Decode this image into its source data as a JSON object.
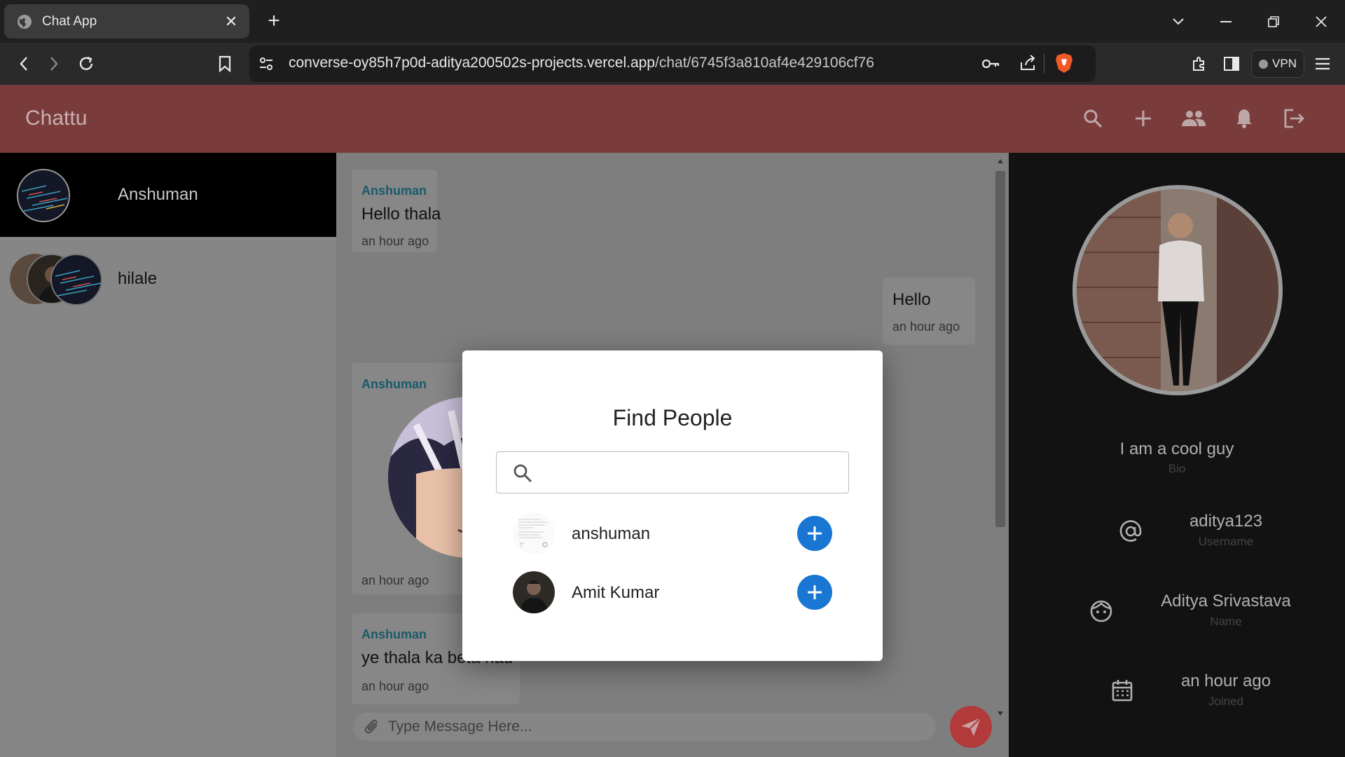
{
  "browser": {
    "tab_title": "Chat App",
    "url_host": "converse-oy85h7p0d-aditya200502s-projects.vercel.app",
    "url_path": "/chat/6745f3a810af4e429106cf76",
    "vpn_label": "VPN"
  },
  "app": {
    "brand": "Chattu",
    "header_color": "#7a3b3b"
  },
  "sidebar": {
    "chats": [
      {
        "name": "Anshuman",
        "active": true
      },
      {
        "name": "hilale",
        "active": false
      }
    ]
  },
  "messages": [
    {
      "sender": "Anshuman",
      "text": "Hello thala",
      "time": "an hour ago"
    },
    {
      "sender": "",
      "text": "Hello",
      "time": "an hour ago"
    },
    {
      "sender": "Anshuman",
      "text": "",
      "time": "an hour ago"
    },
    {
      "sender": "Anshuman",
      "text": "ye thala ka beta hau",
      "time": "an hour ago"
    }
  ],
  "composer": {
    "placeholder": "Type Message Here..."
  },
  "profile": {
    "bio": "I am a cool guy",
    "bio_label": "Bio",
    "username": "aditya123",
    "username_label": "Username",
    "name": "Aditya Srivastava",
    "name_label": "Name",
    "joined": "an hour ago",
    "joined_label": "Joined"
  },
  "modal": {
    "title": "Find People",
    "search_value": "",
    "people": [
      {
        "name": "anshuman"
      },
      {
        "name": "Amit Kumar"
      }
    ]
  }
}
